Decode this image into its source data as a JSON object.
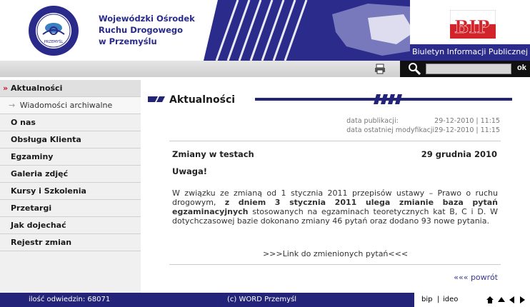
{
  "header": {
    "org_name_lines": [
      "Wojewódzki Ośrodek",
      "Ruchu Drogowego",
      "w Przemyślu"
    ],
    "logo_ring_text": "WOJEWÓDZKI OŚRODEK RUCHU DROGOWEGO",
    "logo_city_text": "PRZEMYŚL",
    "bip_logo_text": "BIP",
    "bip_caption": "Biuletyn Informacji Publicznej"
  },
  "toolbar": {
    "print_icon": "printer-icon",
    "search_icon": "magnifier-icon",
    "search_value": "",
    "ok_label": "ok"
  },
  "nav": {
    "items": [
      {
        "label": "Aktualności",
        "active": true
      },
      {
        "label": "Wiadomości archiwalne",
        "sub": true
      },
      {
        "label": "O nas"
      },
      {
        "label": "Obsługa Klienta"
      },
      {
        "label": "Egzaminy"
      },
      {
        "label": "Galeria zdjęć"
      },
      {
        "label": "Kursy i Szkolenia"
      },
      {
        "label": "Przetargi"
      },
      {
        "label": "Jak dojechać"
      },
      {
        "label": "Rejestr zmian"
      }
    ],
    "active_arrow": "»",
    "sub_arrow": "→"
  },
  "main": {
    "heading": "Aktualności",
    "meta": {
      "pub_label": "data publikacji:",
      "pub_value": "29-12-2010 | 11:15",
      "mod_label": "data ostatniej modyfikacji:",
      "mod_value": "29-12-2010 | 11:15"
    },
    "article": {
      "title": "Zmiany w testach",
      "date": "29 grudnia 2010",
      "uwaga": "Uwaga!",
      "body_1": "W związku ze zmianą od 1 stycznia 2011 przepisów ustawy – Prawo o ruchu drogowym, ",
      "body_bold": "z dniem 3 stycznia 2011 ulega zmianie baza pytań egzaminacyjnych",
      "body_2": " stosowanych na egzaminach teoretycznych kat B, C i D. W dotychczasowej bazie dokonano zmiany  46 pytań oraz dodano 93 nowe pytania.",
      "link": ">>>Link do zmienionych pytań<<<"
    },
    "back_link": "««« powrót"
  },
  "footer": {
    "visits": "ilość odwiedzin: 68071",
    "copyright": "(c) WORD Przemyśl",
    "bip": "bip",
    "sep": "|",
    "ideo": "ideo"
  },
  "colors": {
    "brand_navy": "#23237a",
    "accent_red": "#c8102e"
  }
}
